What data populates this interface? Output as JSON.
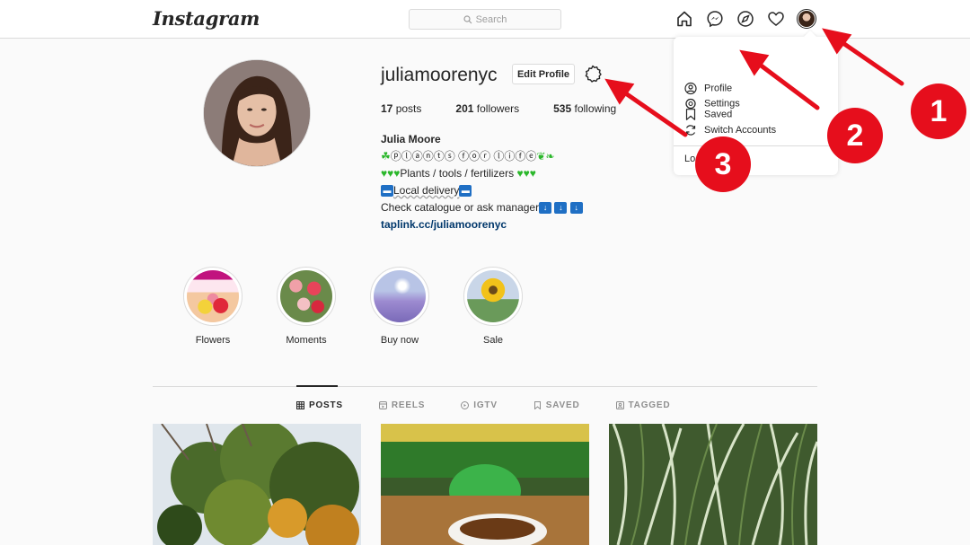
{
  "nav": {
    "logo": "Instagram",
    "search_placeholder": "Search",
    "icons": [
      "home-icon",
      "messenger-icon",
      "explore-icon",
      "heart-icon",
      "avatar"
    ]
  },
  "dropdown": {
    "items": [
      {
        "label": "Profile",
        "icon": "user-circle-icon"
      },
      {
        "label": "Saved",
        "icon": "bookmark-icon"
      },
      {
        "label": "Settings",
        "icon": "gear-icon"
      },
      {
        "label": "Switch Accounts",
        "icon": "switch-icon"
      }
    ],
    "logout": "Lo"
  },
  "profile": {
    "username": "juliamoorenyc",
    "edit_label": "Edit Profile",
    "stats": [
      {
        "count": "17",
        "label": "posts"
      },
      {
        "count": "201",
        "label": "followers"
      },
      {
        "count": "535",
        "label": "following"
      }
    ],
    "name": "Julia Moore",
    "bio_line1": "ⓟⓛⓐⓝⓣⓢ ⓕⓞⓡ ⓛⓘⓕⓔ",
    "bio_line2": "Plants / tools / fertilizers",
    "bio_line3": "Local delivery",
    "bio_line4": "Check catalogue or ask manager",
    "link": "taplink.cc/juliamoorenyc"
  },
  "highlights": [
    {
      "label": "Flowers"
    },
    {
      "label": "Moments"
    },
    {
      "label": "Buy now"
    },
    {
      "label": "Sale"
    }
  ],
  "tabs": [
    {
      "label": "POSTS",
      "icon": "grid-icon"
    },
    {
      "label": "REELS",
      "icon": "reels-icon"
    },
    {
      "label": "IGTV",
      "icon": "igtv-icon"
    },
    {
      "label": "SAVED",
      "icon": "bookmark-icon"
    },
    {
      "label": "TAGGED",
      "icon": "tag-icon"
    }
  ],
  "annotations": [
    "1",
    "2",
    "3"
  ],
  "colors": {
    "annotation_red": "#e60e1c",
    "link_blue": "#00376b",
    "border": "#dbdbdb"
  }
}
